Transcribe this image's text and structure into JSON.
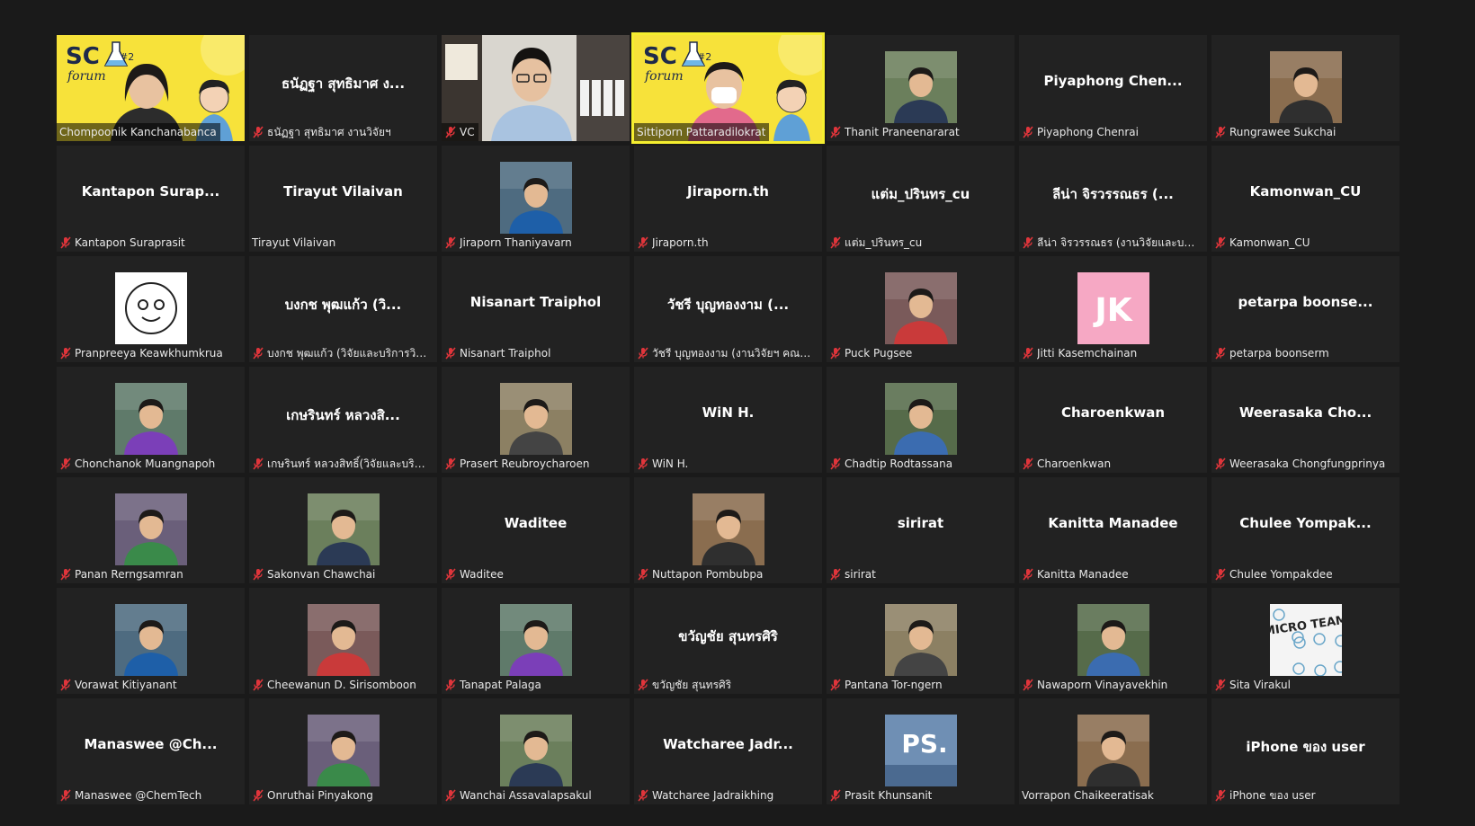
{
  "meeting": {
    "participants": [
      {
        "name": "Chompoonik Kanchanabanca",
        "display": "",
        "muted": false,
        "tile": "video-sc"
      },
      {
        "name": "ธนัฏฐา สุทธิมาศ งานวิจัยฯ",
        "display": "ธนัฏฐา สุทธิมาศ ง...",
        "muted": true,
        "tile": "name"
      },
      {
        "name": "VC",
        "display": "",
        "muted": true,
        "tile": "video-office"
      },
      {
        "name": "Sittiporn Pattaradilokrat",
        "display": "",
        "muted": false,
        "tile": "video-sc-speaking"
      },
      {
        "name": "Thanit Praneenararat",
        "display": "",
        "muted": true,
        "tile": "photo"
      },
      {
        "name": "Piyaphong Chenrai",
        "display": "Piyaphong  Chen...",
        "muted": true,
        "tile": "name"
      },
      {
        "name": "Rungrawee Sukchai",
        "display": "",
        "muted": true,
        "tile": "photo"
      },
      {
        "name": "Kantapon Suraprasit",
        "display": "Kantapon  Surap...",
        "muted": true,
        "tile": "name"
      },
      {
        "name": "Tirayut Vilaivan",
        "display": "Tirayut Vilaivan",
        "muted": false,
        "tile": "name"
      },
      {
        "name": "Jiraporn Thaniyavarn",
        "display": "",
        "muted": true,
        "tile": "photo"
      },
      {
        "name": "Jiraporn.th",
        "display": "Jiraporn.th",
        "muted": true,
        "tile": "name"
      },
      {
        "name": "แต่ม_ปรินทร_cu",
        "display": "แต่ม_ปรินทร_cu",
        "muted": true,
        "tile": "name"
      },
      {
        "name": "ลีน่า จิรวรรณธร  (งานวิจัยและบริก...",
        "display": "ลีน่า จิรวรรณธร  (...",
        "muted": true,
        "tile": "name"
      },
      {
        "name": "Kamonwan_CU",
        "display": "Kamonwan_CU",
        "muted": true,
        "tile": "name"
      },
      {
        "name": "Pranpreeya Keawkhumkrua",
        "display": "",
        "muted": true,
        "tile": "avatar-face"
      },
      {
        "name": "บงกช พุฒแก้ว (วิจัยและบริการวิชาก...",
        "display": "บงกช พุฒแก้ว (วิ...",
        "muted": true,
        "tile": "name"
      },
      {
        "name": "Nisanart Traiphol",
        "display": "Nisanart Traiphol",
        "muted": true,
        "tile": "name"
      },
      {
        "name": "วัชรี บุญทองงาม (งานวิจัยฯ คณะวิ...",
        "display": "วัชรี บุญทองงาม (...",
        "muted": true,
        "tile": "name"
      },
      {
        "name": "Puck Pugsee",
        "display": "",
        "muted": true,
        "tile": "photo"
      },
      {
        "name": "Jitti Kasemchainan",
        "display": "",
        "muted": true,
        "tile": "avatar-jk",
        "avatar_text": "JK"
      },
      {
        "name": "petarpa boonserm",
        "display": "petarpa  boonse...",
        "muted": true,
        "tile": "name"
      },
      {
        "name": "Chonchanok Muangnapoh",
        "display": "",
        "muted": true,
        "tile": "photo"
      },
      {
        "name": "เกษรินทร์ หลวงสิทธิ์(วิจัยและบริการ...",
        "display": "เกษรินทร์ หลวงสิ...",
        "muted": true,
        "tile": "name"
      },
      {
        "name": "Prasert Reubroycharoen",
        "display": "",
        "muted": true,
        "tile": "photo"
      },
      {
        "name": "WiN H.",
        "display": "WiN H.",
        "muted": true,
        "tile": "name"
      },
      {
        "name": "Chadtip Rodtassana",
        "display": "",
        "muted": true,
        "tile": "photo"
      },
      {
        "name": "Charoenkwan",
        "display": "Charoenkwan",
        "muted": true,
        "tile": "name"
      },
      {
        "name": "Weerasaka Chongfungprinya",
        "display": "Weerasaka  Cho...",
        "muted": true,
        "tile": "name"
      },
      {
        "name": "Panan Rerngsamran",
        "display": "",
        "muted": true,
        "tile": "photo"
      },
      {
        "name": "Sakonvan Chawchai",
        "display": "",
        "muted": true,
        "tile": "photo"
      },
      {
        "name": "Waditee",
        "display": "Waditee",
        "muted": true,
        "tile": "name"
      },
      {
        "name": "Nuttapon Pombubpa",
        "display": "",
        "muted": true,
        "tile": "photo"
      },
      {
        "name": "sirirat",
        "display": "sirirat",
        "muted": true,
        "tile": "name"
      },
      {
        "name": "Kanitta Manadee",
        "display": "Kanitta Manadee",
        "muted": true,
        "tile": "name"
      },
      {
        "name": "Chulee Yompakdee",
        "display": "Chulee  Yompak...",
        "muted": true,
        "tile": "name"
      },
      {
        "name": "Vorawat Kitiyanant",
        "display": "",
        "muted": true,
        "tile": "photo"
      },
      {
        "name": "Cheewanun D. Sirisomboon",
        "display": "",
        "muted": true,
        "tile": "photo"
      },
      {
        "name": "Tanapat Palaga",
        "display": "",
        "muted": true,
        "tile": "photo"
      },
      {
        "name": "ขวัญชัย สุนทรศิริ",
        "display": "ขวัญชัย สุนทรศิริ",
        "muted": true,
        "tile": "name"
      },
      {
        "name": "Pantana Tor-ngern",
        "display": "",
        "muted": true,
        "tile": "photo"
      },
      {
        "name": "Nawaporn Vinayavekhin",
        "display": "",
        "muted": true,
        "tile": "photo"
      },
      {
        "name": "Sita Virakul",
        "display": "",
        "muted": true,
        "tile": "avatar-micro",
        "avatar_text": "MICRO TEAM"
      },
      {
        "name": "Manaswee @ChemTech",
        "display": "Manaswee  @Ch...",
        "muted": true,
        "tile": "name"
      },
      {
        "name": "Onruthai Pinyakong",
        "display": "",
        "muted": true,
        "tile": "photo"
      },
      {
        "name": "Wanchai Assavalapsakul",
        "display": "",
        "muted": true,
        "tile": "photo"
      },
      {
        "name": "Watcharee Jadraikhing",
        "display": "Watcharee  Jadr...",
        "muted": true,
        "tile": "name"
      },
      {
        "name": "Prasit Khunsanit",
        "display": "",
        "muted": true,
        "tile": "avatar-ps",
        "avatar_text": "PS."
      },
      {
        "name": "Vorrapon Chaikeeratisak",
        "display": "",
        "muted": false,
        "tile": "photo"
      },
      {
        "name": "iPhone ของ user",
        "display": "iPhone ของ user",
        "muted": true,
        "tile": "name"
      }
    ],
    "sc_banner": {
      "sc": "SC",
      "forum": "forum",
      "hash": "#2"
    }
  },
  "colors": {
    "background": "#1a1a1a",
    "tile": "#222222",
    "active_speaker": "#f5ee2f",
    "mute_icon": "#e0353b",
    "banner_yellow": "#f7e23a"
  }
}
